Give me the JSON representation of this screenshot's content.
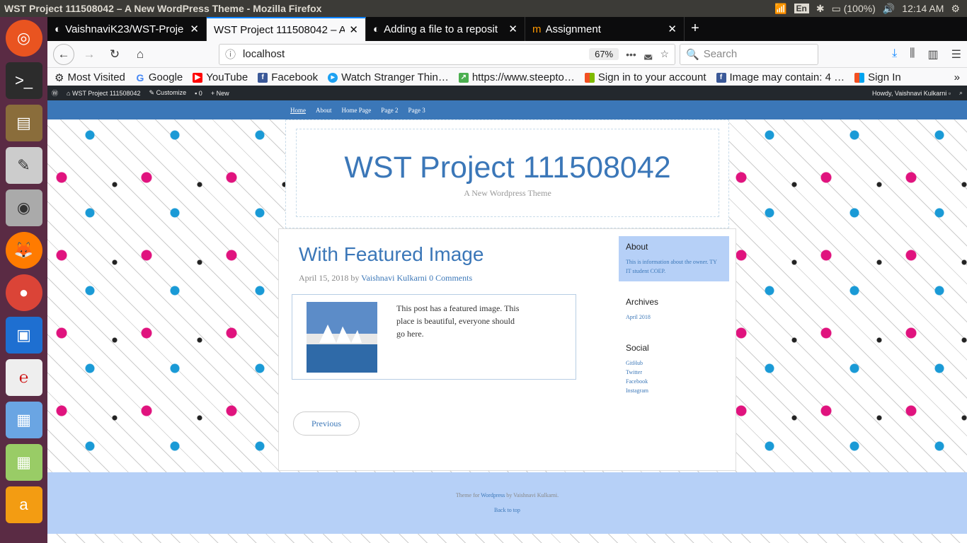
{
  "os": {
    "window_title": "WST Project 111508042 – A New WordPress Theme - Mozilla Firefox",
    "lang": "En",
    "battery": "(100%)",
    "time": "12:14 AM"
  },
  "tabs": [
    {
      "title": "VaishnaviK23/WST-Proje",
      "icon": "github-icon"
    },
    {
      "title": "WST Project 111508042 – A N",
      "icon": "none"
    },
    {
      "title": "Adding a file to a reposit",
      "icon": "github-icon"
    },
    {
      "title": "Assignment",
      "icon": "moodle-icon"
    }
  ],
  "nav": {
    "url": "localhost",
    "zoom": "67%",
    "search_placeholder": "Search"
  },
  "bookmarks": [
    {
      "label": "Most Visited",
      "color": "#555"
    },
    {
      "label": "Google",
      "color": "#4285f4"
    },
    {
      "label": "YouTube",
      "color": "#ff0000"
    },
    {
      "label": "Facebook",
      "color": "#3b5998"
    },
    {
      "label": "Watch Stranger Thin…",
      "color": "#1da1f2"
    },
    {
      "label": "https://www.steepto…",
      "color": "#4caf50"
    },
    {
      "label": "Sign in to your account",
      "color": "#f25022"
    },
    {
      "label": "Image may contain: 4 …",
      "color": "#3b5998"
    },
    {
      "label": "Sign In",
      "color": "#f25022"
    }
  ],
  "wp_admin": {
    "site": "WST Project 111508042",
    "customize": "Customize",
    "comments": "0",
    "new": "New",
    "howdy": "Howdy, Vaishnavi Kulkarni"
  },
  "menu": [
    "Home",
    "About",
    "Home Page",
    "Page 2",
    "Page 3"
  ],
  "site": {
    "title": "WST Project 111508042",
    "description": "A New Wordpress Theme"
  },
  "post": {
    "title": "With Featured Image",
    "date": "April 15, 2018",
    "by": "by",
    "author": "Vaishnavi Kulkarni",
    "comments": "0 Comments",
    "excerpt": "This post has a featured image. This place is beautiful, everyone should go here."
  },
  "pagination": {
    "previous": "Previous"
  },
  "sidebar": {
    "about": {
      "title": "About",
      "text": "This is information about the owner. TY IT student COEP."
    },
    "archives": {
      "title": "Archives",
      "items": [
        "April 2018"
      ]
    },
    "social": {
      "title": "Social",
      "items": [
        "GitHub",
        "Twitter",
        "Facebook",
        "Instagram"
      ]
    }
  },
  "footer": {
    "theme_for": "Theme for",
    "wordpress": "Wordpress",
    "by": "by Vaishnavi Kulkarni.",
    "back_to_top": "Back to top"
  },
  "colors": {
    "accent": "#3b77b8",
    "highlight": "#b6d0f7",
    "launcher": "#5a2b44"
  }
}
